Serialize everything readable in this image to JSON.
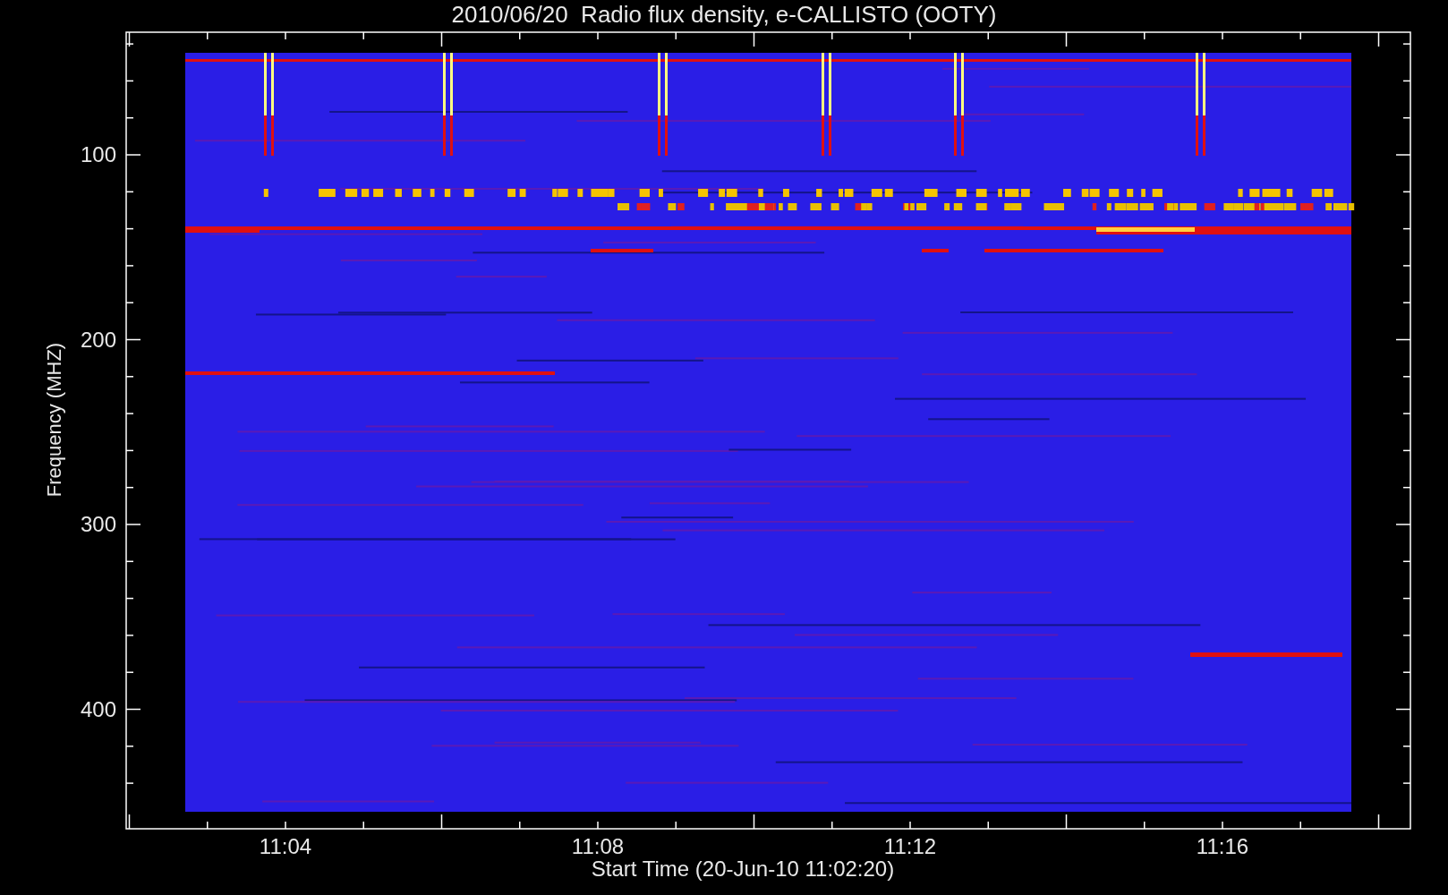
{
  "title": "2010/06/20  Radio flux density, e-CALLISTO (OOTY)",
  "y_axis": {
    "label": "Frequency (MHZ)",
    "ticks": [
      "100",
      "200",
      "300",
      "400"
    ]
  },
  "x_axis": {
    "label": "Start Time (20-Jun-10 11:02:20)",
    "ticks": [
      "11:04",
      "11:08",
      "11:12",
      "11:16"
    ]
  }
}
